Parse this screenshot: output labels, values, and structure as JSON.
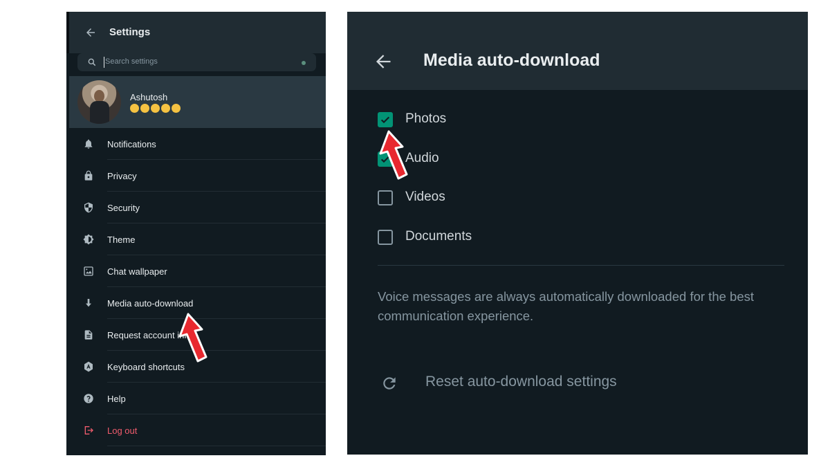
{
  "settings": {
    "title": "Settings",
    "search_placeholder": "Search settings",
    "profile": {
      "name": "Ashutosh",
      "status_emoji_count": 5
    },
    "items": [
      {
        "label": "Notifications",
        "icon": "bell-icon"
      },
      {
        "label": "Privacy",
        "icon": "lock-icon"
      },
      {
        "label": "Security",
        "icon": "shield-icon"
      },
      {
        "label": "Theme",
        "icon": "theme-icon"
      },
      {
        "label": "Chat wallpaper",
        "icon": "wallpaper-icon"
      },
      {
        "label": "Media auto-download",
        "icon": "download-icon"
      },
      {
        "label": "Request account info",
        "icon": "document-icon"
      },
      {
        "label": "Keyboard shortcuts",
        "icon": "keyboard-shortcuts-icon"
      },
      {
        "label": "Help",
        "icon": "help-icon"
      },
      {
        "label": "Log out",
        "icon": "logout-icon"
      }
    ]
  },
  "media": {
    "title": "Media auto-download",
    "options": [
      {
        "label": "Photos",
        "checked": true
      },
      {
        "label": "Audio",
        "checked": true
      },
      {
        "label": "Videos",
        "checked": false
      },
      {
        "label": "Documents",
        "checked": false
      }
    ],
    "note": "Voice messages are always automatically downloaded for the best communication experience.",
    "reset_label": "Reset auto-download settings"
  },
  "colors": {
    "panel_bg": "#111b21",
    "header_bg": "#202c33",
    "accent_green": "#00a884",
    "logout_red": "#f15c6d",
    "annotation_arrow": "#e8282f"
  }
}
